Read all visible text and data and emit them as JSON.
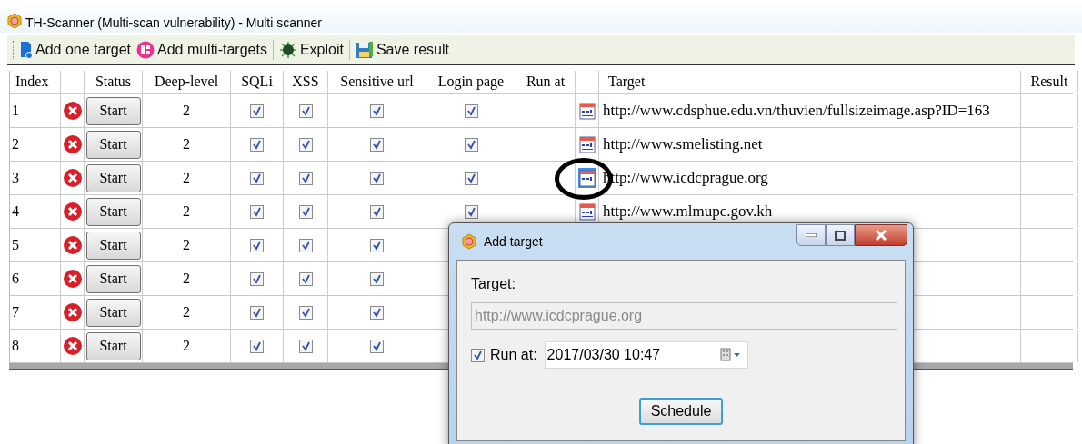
{
  "window": {
    "title": "TH-Scanner (Multi-scan vulnerability) - Multi scanner"
  },
  "toolbar": [
    {
      "kind": "add-one",
      "label": "Add one target"
    },
    {
      "kind": "add-multi",
      "label": "Add multi-targets"
    },
    {
      "kind": "exploit",
      "label": "Exploit"
    },
    {
      "kind": "save",
      "label": "Save result"
    }
  ],
  "table": {
    "columns": [
      "Index",
      "Status",
      "Deep-level",
      "SQLi",
      "XSS",
      "Sensitive url",
      "Login page",
      "Run at",
      "Target",
      "Result"
    ],
    "rows": [
      {
        "index": "1",
        "kind": "error",
        "action": "Start",
        "deep_level": "2",
        "sqli": true,
        "xss": true,
        "sensitive_url": true,
        "login_page": true,
        "selected": false,
        "target": "http://www.cdsphue.edu.vn/thuvien/fullsizeimage.asp?ID=163"
      },
      {
        "index": "2",
        "kind": "error",
        "action": "Start",
        "deep_level": "2",
        "sqli": true,
        "xss": true,
        "sensitive_url": true,
        "login_page": true,
        "selected": false,
        "target": "http://www.smelisting.net"
      },
      {
        "index": "3",
        "kind": "error",
        "action": "Start",
        "deep_level": "2",
        "sqli": true,
        "xss": true,
        "sensitive_url": true,
        "login_page": true,
        "selected": true,
        "target": "http://www.icdcprague.org"
      },
      {
        "index": "4",
        "kind": "error",
        "action": "Start",
        "deep_level": "2",
        "sqli": true,
        "xss": true,
        "sensitive_url": true,
        "login_page": true,
        "selected": false,
        "target": "http://www.mlmupc.gov.kh"
      },
      {
        "index": "5",
        "kind": "error",
        "action": "Start",
        "deep_level": "2",
        "sqli": true,
        "xss": true,
        "sensitive_url": true
      },
      {
        "index": "6",
        "kind": "error",
        "action": "Start",
        "deep_level": "2",
        "sqli": true,
        "xss": true,
        "sensitive_url": true
      },
      {
        "index": "7",
        "kind": "error",
        "action": "Start",
        "deep_level": "2",
        "sqli": true,
        "xss": true,
        "sensitive_url": true
      },
      {
        "index": "8",
        "kind": "error",
        "action": "Start",
        "deep_level": "2",
        "sqli": true,
        "xss": true,
        "sensitive_url": true
      }
    ]
  },
  "dialog": {
    "title": "Add target",
    "target_label": "Target:",
    "target_value": "http://www.icdcprague.org",
    "run_at_checked": true,
    "run_at_label": "Run at:",
    "run_at_value": "2017/03/30 10:47",
    "button": "Schedule"
  }
}
